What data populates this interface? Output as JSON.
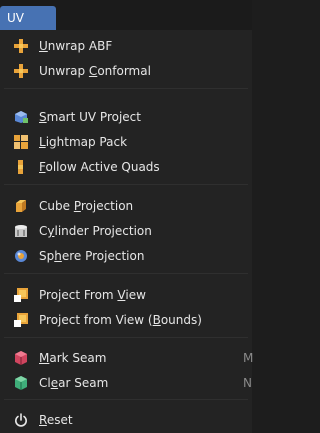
{
  "menu": {
    "title": "UV",
    "items": [
      {
        "pre": "",
        "key": "U",
        "post": "nwrap ABF",
        "icon": "unwrap-icon",
        "shortcut": ""
      },
      {
        "pre": "Unwrap ",
        "key": "C",
        "post": "onformal",
        "icon": "unwrap-icon",
        "shortcut": ""
      },
      {
        "pre": "",
        "key": "S",
        "post": "mart UV Project",
        "icon": "smart-uv-project-icon",
        "shortcut": ""
      },
      {
        "pre": "",
        "key": "L",
        "post": "ightmap Pack",
        "icon": "lightmap-pack-icon",
        "shortcut": ""
      },
      {
        "pre": "",
        "key": "F",
        "post": "ollow Active Quads",
        "icon": "follow-active-quads-icon",
        "shortcut": ""
      },
      {
        "pre": "Cube ",
        "key": "P",
        "post": "rojection",
        "icon": "cube-projection-icon",
        "shortcut": ""
      },
      {
        "pre": "C",
        "key": "y",
        "post": "linder Projection",
        "icon": "cylinder-projection-icon",
        "shortcut": ""
      },
      {
        "pre": "Sp",
        "key": "h",
        "post": "ere Projection",
        "icon": "sphere-projection-icon",
        "shortcut": ""
      },
      {
        "pre": "Project From ",
        "key": "V",
        "post": "iew",
        "icon": "project-from-view-icon",
        "shortcut": ""
      },
      {
        "pre": "Project from View (",
        "key": "B",
        "post": "ounds)",
        "icon": "project-from-view-icon",
        "shortcut": ""
      },
      {
        "pre": "",
        "key": "M",
        "post": "ark Seam",
        "icon": "mark-seam-icon",
        "shortcut": "M"
      },
      {
        "pre": "Cl",
        "key": "e",
        "post": "ar Seam",
        "icon": "clear-seam-icon",
        "shortcut": "N"
      },
      {
        "pre": "",
        "key": "R",
        "post": "eset",
        "icon": "reset-icon",
        "shortcut": ""
      }
    ]
  },
  "colors": {
    "header_tab": "#4772b3",
    "menu_background": "#232323",
    "text": "#e6e6e6"
  }
}
